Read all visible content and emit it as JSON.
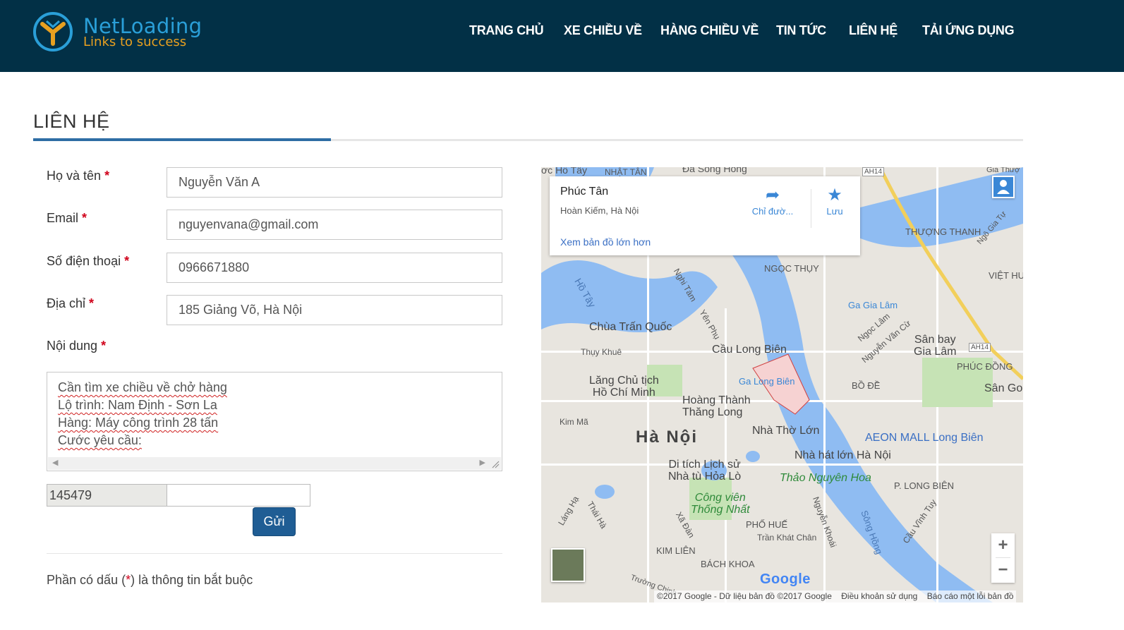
{
  "brand": {
    "name": "NetLoading",
    "slogan": "Links to success"
  },
  "nav": [
    "TRANG CHỦ",
    "XE CHIỀU VỀ",
    "HÀNG CHIỀU VỀ",
    "TIN TỨC",
    "LIÊN HỆ",
    "TẢI ỨNG DỤNG"
  ],
  "page_title": "LIÊN HỆ",
  "form": {
    "required_mark": "*",
    "name_label": "Họ và tên",
    "name_value": "Nguyễn Văn A",
    "email_label": "Email",
    "email_value": "nguyenvana@gmail.com",
    "phone_label": "Số điện thoại",
    "phone_value": "0966671880",
    "address_label": "Địa chỉ",
    "address_value": "185 Giảng Võ, Hà Nội",
    "content_label": "Nội dung",
    "content_lines": [
      "Cần tìm xe chiều về chở hàng",
      "Lộ trình: Nam Định - Sơn La",
      "Hàng: Máy công trình 28 tấn",
      "Cước yêu cầu:"
    ],
    "captcha_code": "145479",
    "captcha_input": "",
    "submit": "Gửi",
    "note_prefix": "Phần có dấu (",
    "note_suffix": ") là thông tin bắt buộc"
  },
  "map": {
    "place_name": "Phúc Tân",
    "place_area": "Hoàn Kiếm, Hà Nội",
    "directions": "Chỉ đườ...",
    "save": "Lưu",
    "larger_map": "Xem bản đồ lớn hơn",
    "zoom_in": "+",
    "zoom_out": "−",
    "google": "Google",
    "attribution": [
      "©2017 Google - Dữ liệu bản đồ ©2017 Google",
      "Điều khoản sử dụng",
      "Báo cáo một lỗi bản đồ"
    ],
    "labels": {
      "ho_tay": "Hồ Tây",
      "chua_tran_quoc": "Chùa Trấn Quốc",
      "cau_long_bien": "Cầu Long Biên",
      "ga_long_bien": "Ga Long Biên",
      "lang_chu_tich": "Lăng Chủ tịch\nHồ Chí Minh",
      "hoang_thanh": "Hoàng Thành\nThăng Long",
      "ha_noi": "Hà Nội",
      "nha_tho_lon": "Nhà Thờ Lớn",
      "nha_hat_lon": "Nhà hát lớn Hà Nội",
      "di_tich_hoa_lo": "Di tích Lịch sử\nNhà tù Hỏa Lò",
      "thao_nguyen_hoa": "Thảo Nguyên Hoa",
      "cong_vien_thong_nhat": "Công viên\nThống Nhất",
      "aeon_mall": "AEON MALL Long Biên",
      "san_bay_gia_lam": "Sân bay\nGia Lâm",
      "ga_gia_lam": "Ga Gia Lâm",
      "thuong_thanh": "THƯỢNG THANH",
      "ngoc_thuy": "NGỌC THỤY",
      "viet_hung": "VIỆT HU",
      "phuc_dong": "PHÚC ĐỒNG",
      "bo_de": "BỒ ĐỀ",
      "p_long_bien": "P. LONG BIÊN",
      "pho_hue": "PHỐ HUẾ",
      "kim_lien": "KIM LIÊN",
      "bach_khoa": "BÁCH KHOA",
      "tran_khat_chan": "Trần Khát Chân",
      "song_hong": "Sông Hồng",
      "san_go": "Sân Go",
      "nhat_tan": "NHẬT TÂN",
      "dai_song_hong": "Đa Sông Hồng",
      "ah14": "AH14",
      "thuy_khue": "Thụy Khuê",
      "kim_ma": "Kim Mã",
      "nghi_tam": "Nghi Tàm",
      "yen_phu": "Yên Phụ",
      "ngoc_lam": "Ngọc Lâm",
      "nguyen_van_cu": "Nguyễn Văn Cừ",
      "ngo_gia_tu": "Ngô Gia Tự",
      "lang_ha": "Láng Hạ",
      "thai_ha": "Thái Hà",
      "xa_dan": "Xã Đàn",
      "truong_chinh": "Trường Chinh",
      "nguyen_khoai": "Nguyễn Khoái",
      "cau_vinh_tuy": "Cầu Vĩnh Tuy",
      "ho_tay_road": "ơc Hồ Tây",
      "giai": "Gia Thượ"
    }
  }
}
